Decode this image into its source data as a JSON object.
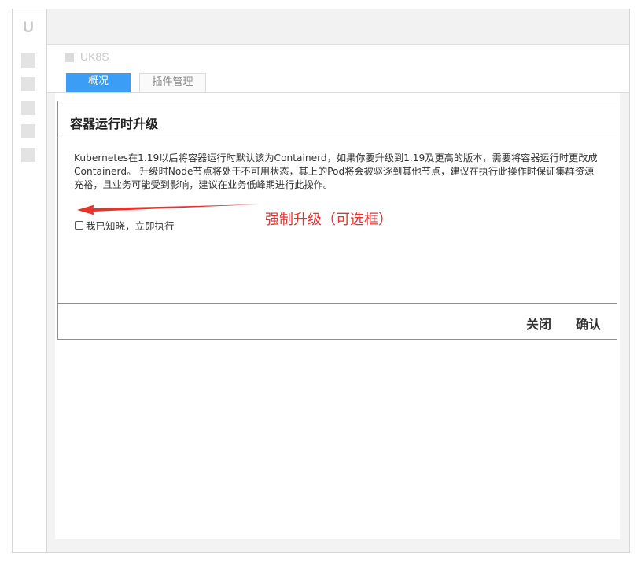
{
  "rail": {
    "logo": "U",
    "icons": [
      "nav-square-icon",
      "nav-square-icon",
      "nav-square-icon",
      "nav-square-icon",
      "nav-square-icon"
    ]
  },
  "header": {
    "product_name": "UK8S",
    "tabs": [
      {
        "label": "概况",
        "active": true
      },
      {
        "label": "插件管理",
        "active": false
      }
    ]
  },
  "modal": {
    "title": "容器运行时升级",
    "description": "Kubernetes在1.19以后将容器运行时默认该为Containerd，如果你要升级到1.19及更高的版本，需要将容器运行时更改成Containerd。 升级时Node节点将处于不可用状态，其上的Pod将会被驱逐到其他节点，建议在执行此操作时保证集群资源充裕，且业务可能受到影响，建议在业务低峰期进行此操作。",
    "checkbox_label": "我已知晓，立即执行",
    "checkbox_checked": false,
    "close_label": "关闭",
    "confirm_label": "确认"
  },
  "annotation": {
    "text": "强制升级（可选框）",
    "color": "#e8332b"
  },
  "colors": {
    "accent": "#3c9df7",
    "annotation": "#e8332b"
  }
}
